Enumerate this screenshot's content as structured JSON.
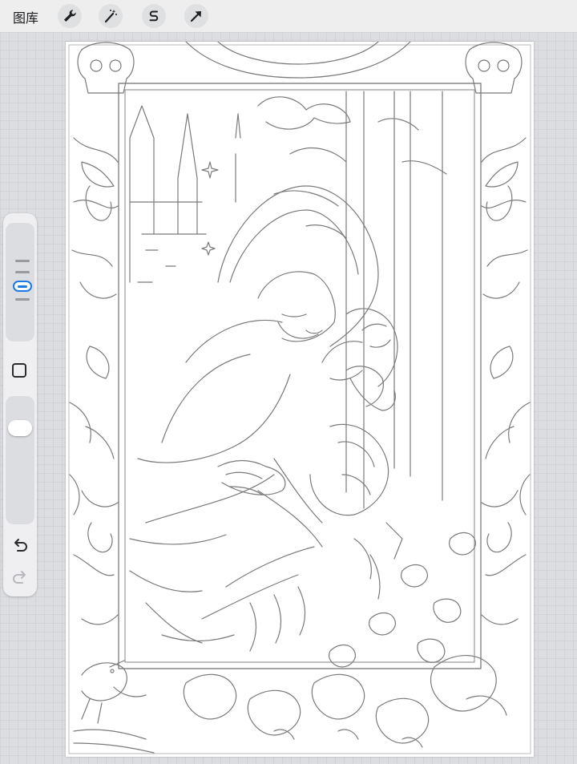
{
  "toolbar": {
    "gallery_label": "图库",
    "tools": [
      {
        "name": "actions",
        "icon": "wrench-icon"
      },
      {
        "name": "adjustments",
        "icon": "magic-wand-icon"
      },
      {
        "name": "selection",
        "icon": "selection-s-icon"
      },
      {
        "name": "transform",
        "icon": "arrow-cursor-icon"
      }
    ]
  },
  "sidebar": {
    "brush_size_icon": "brush-size-slider",
    "modify_icon": "square-icon",
    "opacity_icon": "opacity-slider",
    "undo_icon": "undo-icon",
    "redo_icon": "redo-icon"
  },
  "canvas": {
    "content": "line-art-illustration",
    "background_color": "#ffffff",
    "stroke_color": "#7a7a7a"
  },
  "colors": {
    "accent": "#1e79e6",
    "toolbar_bg": "#eeeeef",
    "workspace_bg": "#dcdde0"
  }
}
